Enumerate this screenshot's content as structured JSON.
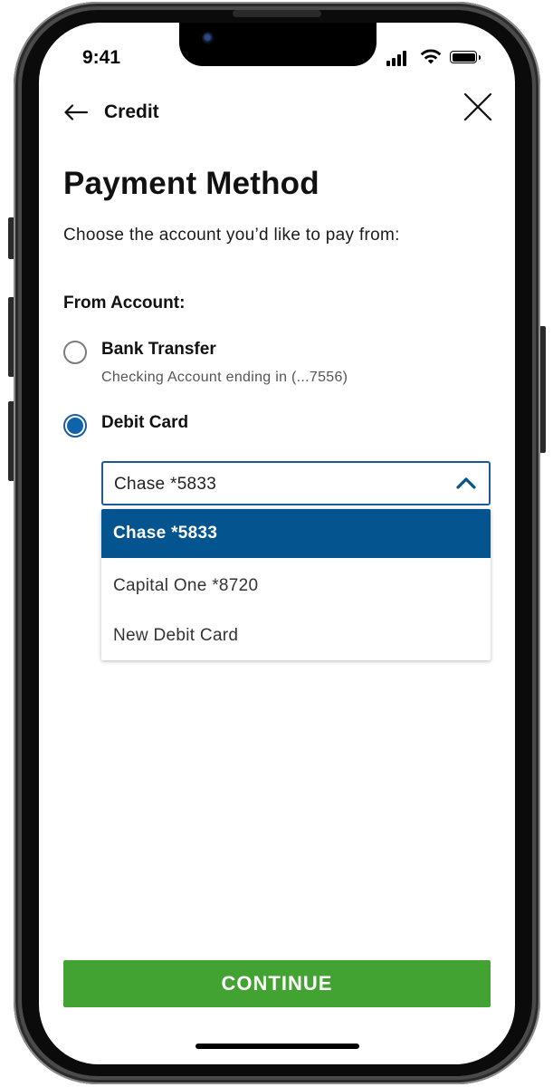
{
  "status_bar": {
    "time": "9:41",
    "icons": [
      "cellular-signal-icon",
      "wifi-icon",
      "battery-icon"
    ]
  },
  "header": {
    "back_label": "Credit",
    "back_icon": "arrow-left-icon",
    "close_icon": "close-icon"
  },
  "page": {
    "title": "Payment Method",
    "subtitle": "Choose the account you’d like to pay from:",
    "section_label": "From Account:"
  },
  "options": [
    {
      "label": "Bank Transfer",
      "sublabel": "Checking Account ending in (...7556)",
      "selected": false
    },
    {
      "label": "Debit Card",
      "sublabel": "",
      "selected": true
    }
  ],
  "card_select": {
    "value": "Chase *5833",
    "expanded": true,
    "items": [
      {
        "label": "Chase *5833",
        "highlighted": true
      },
      {
        "label": "Capital One *8720",
        "highlighted": false
      },
      {
        "label": "New Debit Card",
        "highlighted": false
      }
    ]
  },
  "actions": {
    "continue_label": "CONTINUE"
  },
  "colors": {
    "primary_blue": "#04558f",
    "radio_blue": "#0f62ac",
    "continue_green": "#43a332"
  }
}
